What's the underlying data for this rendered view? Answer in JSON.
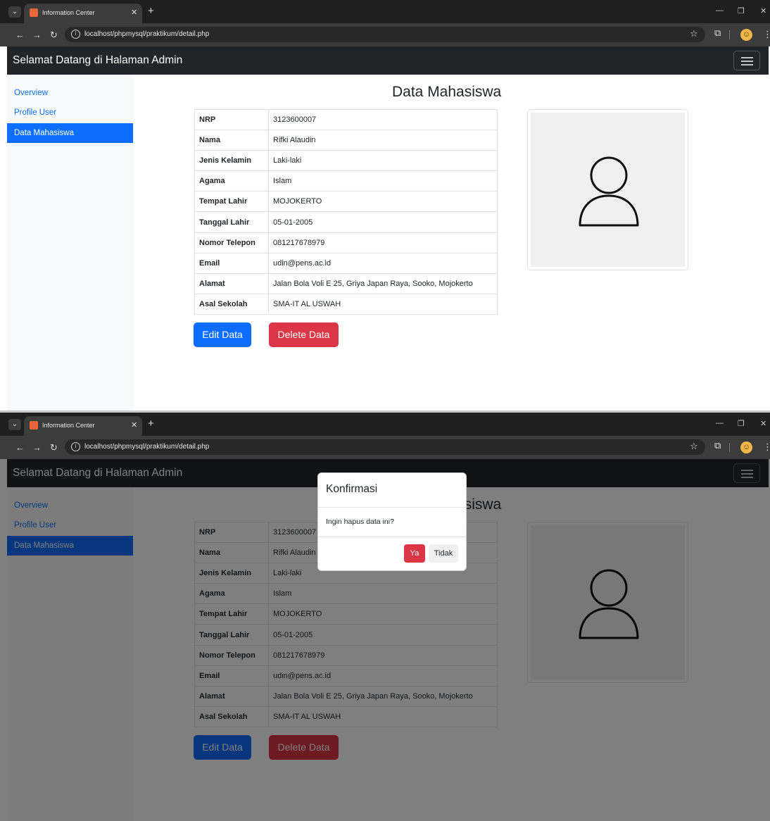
{
  "browser": {
    "tab_title": "Information Center",
    "favicon_text": "☐",
    "new_tab": "+",
    "url": "localhost/phpmysql/praktikum/detail.php"
  },
  "navbar": {
    "brand": "Selamat Datang di Halaman Admin"
  },
  "sidebar": {
    "items": [
      {
        "label": "Overview"
      },
      {
        "label": "Profile User"
      },
      {
        "label": "Data Mahasiswa",
        "active": true
      }
    ]
  },
  "main": {
    "title": "Data Mahasiswa",
    "rows": [
      {
        "key": "NRP",
        "value": "3123600007"
      },
      {
        "key": "Nama",
        "value": "Rifki Alaudin"
      },
      {
        "key": "Jenis Kelamin",
        "value": "Laki-laki"
      },
      {
        "key": "Agama",
        "value": "Islam"
      },
      {
        "key": "Tempat Lahir",
        "value": "MOJOKERTO"
      },
      {
        "key": "Tanggal Lahir",
        "value": "05-01-2005"
      },
      {
        "key": "Nomor Telepon",
        "value": "081217678979"
      },
      {
        "key": "Email",
        "value": "udin@pens.ac.id"
      },
      {
        "key": "Alamat",
        "value": "Jalan Bola Voli E 25, Griya Japan Raya, Sooko, Mojokerto"
      },
      {
        "key": "Asal Sekolah",
        "value": "SMA-IT AL USWAH"
      }
    ],
    "edit_label": "Edit Data",
    "delete_label": "Delete Data"
  },
  "modal": {
    "title": "Konfirmasi",
    "body": "Ingin hapus data ini?",
    "yes_label": "Ya",
    "no_label": "Tidak"
  },
  "colors": {
    "primary": "#0d6efd",
    "danger": "#dc3545",
    "navbar": "#212529",
    "chrome": "#1f1f1f"
  }
}
